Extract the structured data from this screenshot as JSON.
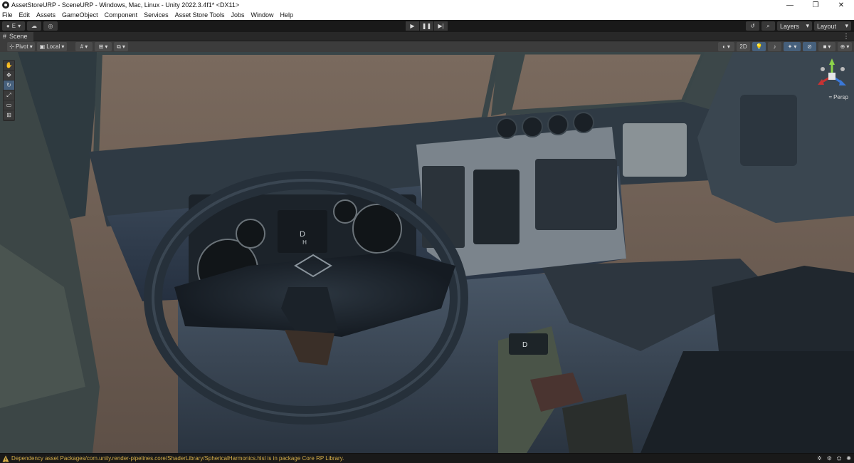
{
  "window": {
    "title": "AssetStoreURP - SceneURP - Windows, Mac, Linux - Unity 2022.3.4f1* <DX11>",
    "controls": {
      "minimize": "—",
      "maximize": "❐",
      "close": "✕"
    }
  },
  "menu": [
    "File",
    "Edit",
    "Assets",
    "GameObject",
    "Component",
    "Services",
    "Asset Store Tools",
    "Jobs",
    "Window",
    "Help"
  ],
  "toolbar": {
    "account_label": "E",
    "layers_label": "Layers",
    "layout_label": "Layout"
  },
  "scene_tab": {
    "label": "Scene"
  },
  "scene_toolbar": {
    "pivot_label": "Pivot",
    "local_label": "Local",
    "mode_2d_label": "2D"
  },
  "gizmo": {
    "persp_label": "Persp"
  },
  "status": {
    "message": "Dependency asset Packages/com.unity.render-pipelines.core/ShaderLibrary/SphericalHarmonics.hlsl is in package Core RP Library."
  },
  "viewport": {
    "gear_letter": "D",
    "instrument_letter_1": "D",
    "instrument_letter_2": "H"
  },
  "colors": {
    "accent_blue": "#46607c",
    "warning": "#d8b049",
    "background": "#191919"
  },
  "icons": {
    "play": "play-icon",
    "pause": "pause-icon",
    "step": "step-icon",
    "hand_tool": "hand-tool-icon",
    "move_tool": "move-tool-icon",
    "rotate_tool": "rotate-tool-icon",
    "scale_tool": "scale-tool-icon",
    "rect_tool": "rect-tool-icon",
    "transform_tool": "transform-tool-icon"
  }
}
